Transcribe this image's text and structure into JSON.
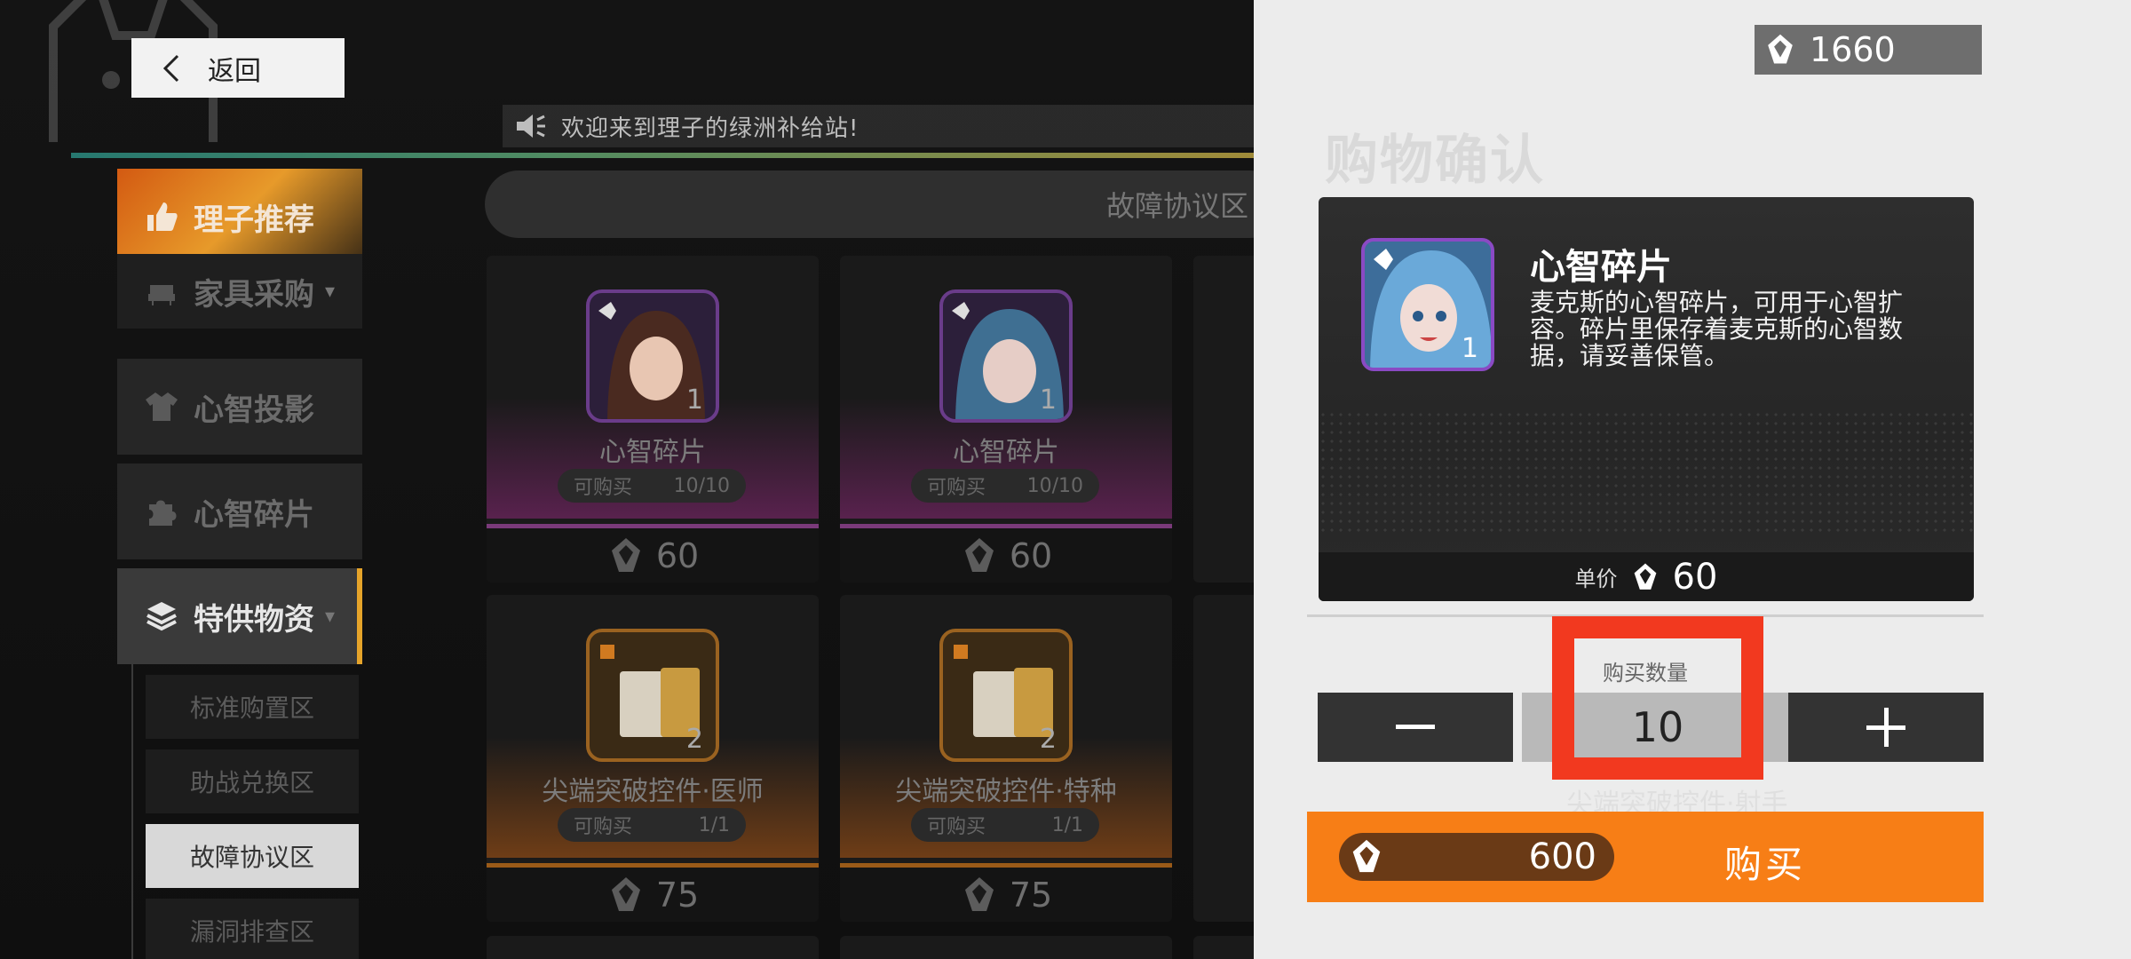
{
  "header": {
    "back_label": "返回",
    "announcement": "欢迎来到理子的绿洲补给站!"
  },
  "sidebar": {
    "items": [
      {
        "label": "理子推荐"
      },
      {
        "label": "家具采购"
      },
      {
        "label": "心智投影"
      },
      {
        "label": "心智碎片"
      },
      {
        "label": "特供物资"
      }
    ],
    "sub_items": [
      {
        "label": "标准购置区"
      },
      {
        "label": "助战兑换区"
      },
      {
        "label": "故障协议区"
      },
      {
        "label": "漏洞排查区"
      }
    ]
  },
  "catalog": {
    "subzone_title": "故障协议区",
    "limit_prefix": "可购买",
    "cards": [
      {
        "name": "心智碎片",
        "limit": "10/10",
        "price": "60",
        "qty": "1"
      },
      {
        "name": "心智碎片",
        "limit": "10/10",
        "price": "60",
        "qty": "1"
      },
      {
        "name": "尖端突破控件·医师",
        "limit": "1/1",
        "price": "75",
        "qty": "2"
      },
      {
        "name": "尖端突破控件·特种",
        "limit": "1/1",
        "price": "75",
        "qty": "2"
      }
    ],
    "partial_card_name": "尖端突破控件·射手"
  },
  "panel": {
    "balance": "1660",
    "title": "购物确认",
    "item": {
      "name": "心智碎片",
      "description": "麦克斯的心智碎片，可用于心智扩容。碎片里保存着麦克斯的心智数据，请妥善保管。",
      "qty": "1"
    },
    "unit_price_label": "单价",
    "unit_price": "60",
    "quantity_label": "购买数量",
    "quantity": "10",
    "minus_symbol": "—",
    "plus_symbol": "+",
    "total": "600",
    "buy_label": "购买"
  },
  "colors": {
    "accent_orange": "#f77e16",
    "highlight_red": "#f2391f",
    "frame_purple": "#8a4ac4"
  }
}
